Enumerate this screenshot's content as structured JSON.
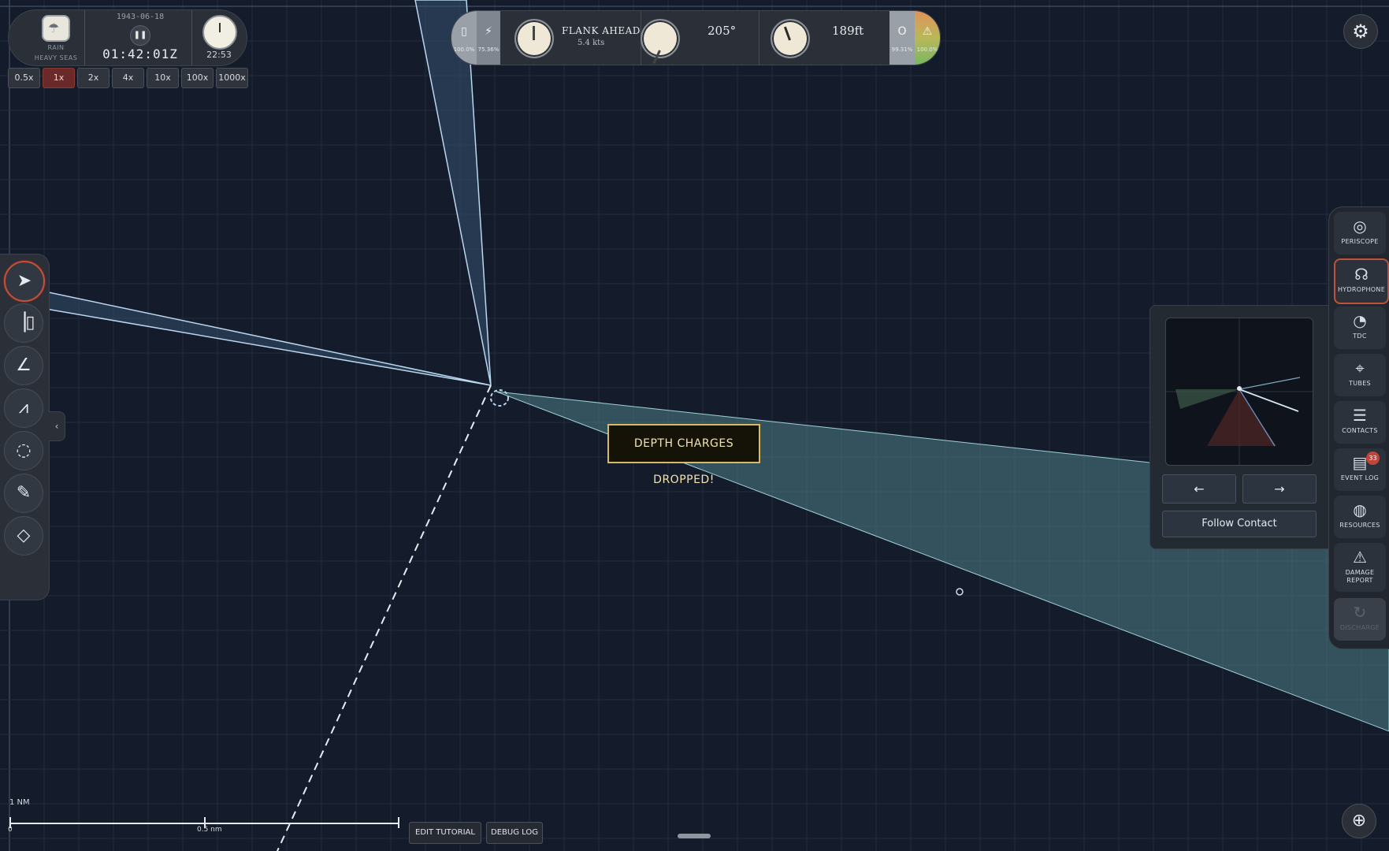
{
  "environment": {
    "weather_icon": "rain-cloud-icon",
    "weather_condition": "RAIN",
    "sea_state": "HEAVY SEAS",
    "date": "1943-06-18",
    "time_utc": "01:42:01Z",
    "local_time": "22:53"
  },
  "time_speeds": [
    "0.5x",
    "1x",
    "2x",
    "4x",
    "10x",
    "100x",
    "1000x"
  ],
  "time_speed_active": "1x",
  "status": {
    "battery_percent": "100.0%",
    "power_percent": "75.36%",
    "speed_order": "FLANK AHEAD",
    "speed_value": "5.4 kts",
    "heading": "205°",
    "depth": "189ft",
    "oxygen_label": "O",
    "oxygen_percent": "99.31%",
    "hull_percent": "100.0%"
  },
  "tools": [
    "select-tool",
    "ruler-tool",
    "protractor-tool",
    "compass-tool",
    "circle-tool",
    "pencil-tool",
    "eraser-tool"
  ],
  "nav": [
    {
      "label": "PERISCOPE",
      "icon": "periscope-icon"
    },
    {
      "label": "HYDROPHONE",
      "icon": "headphones-icon"
    },
    {
      "label": "TDC",
      "icon": "tdc-icon"
    },
    {
      "label": "TUBES",
      "icon": "crosshair-icon"
    },
    {
      "label": "CONTACTS",
      "icon": "list-icon"
    },
    {
      "label": "EVENT LOG",
      "icon": "clipboard-icon",
      "badge": "33"
    },
    {
      "label": "RESOURCES",
      "icon": "resources-icon"
    },
    {
      "label": "DAMAGE REPORT",
      "icon": "warning-icon"
    },
    {
      "label": "DISCHARGE",
      "icon": "discharge-icon"
    }
  ],
  "hydrophone": {
    "prev_label": "←",
    "next_label": "→",
    "follow_label": "Follow Contact"
  },
  "toast": "DEPTH CHARGES DROPPED!",
  "scale": {
    "label": "1 NM",
    "zero": "0",
    "mid": "0.5 nm"
  },
  "bottom": {
    "edit_tutorial": "EDIT TUTORIAL",
    "debug_log": "DEBUG LOG"
  },
  "colors": {
    "background": "#141c2b",
    "grid": "#2c3648",
    "contact_cone": "#4f7f86",
    "sound_cone": "#3b5c7a",
    "alert": "#c0513d",
    "toast_border": "#d6bb62"
  }
}
